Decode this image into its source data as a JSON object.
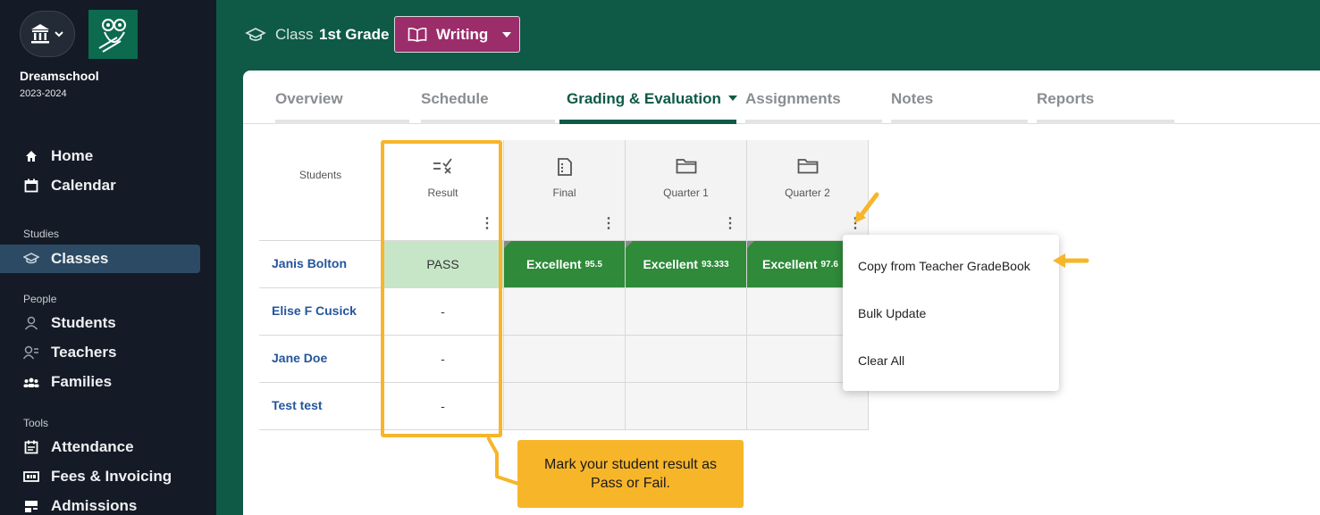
{
  "sidebar": {
    "school_name": "Dreamschool",
    "school_year": "2023-2024",
    "items": [
      {
        "label": "Home",
        "icon": "home-icon"
      },
      {
        "label": "Calendar",
        "icon": "calendar-icon"
      },
      {
        "label": "Classes",
        "icon": "graduation-cap-icon",
        "active": true
      },
      {
        "label": "Students",
        "icon": "person-icon"
      },
      {
        "label": "Teachers",
        "icon": "teacher-icon"
      },
      {
        "label": "Families",
        "icon": "families-icon"
      },
      {
        "label": "Attendance",
        "icon": "attendance-icon"
      },
      {
        "label": "Fees & Invoicing",
        "icon": "invoice-icon"
      },
      {
        "label": "Admissions",
        "icon": "admissions-icon"
      }
    ],
    "sections": {
      "studies": "Studies",
      "people": "People",
      "tools": "Tools"
    }
  },
  "topbar": {
    "class_label": "Class",
    "grade": "1st Grade",
    "subject": "Writing"
  },
  "tabs": [
    "Overview",
    "Schedule",
    "Grading & Evaluation",
    "Assignments",
    "Notes",
    "Reports"
  ],
  "active_tab": "Grading & Evaluation",
  "grid": {
    "students_header": "Students",
    "columns": [
      {
        "label": "Result",
        "icon": "result-check-icon"
      },
      {
        "label": "Final",
        "icon": "document-icon"
      },
      {
        "label": "Quarter 1",
        "icon": "folder-icon"
      },
      {
        "label": "Quarter 2",
        "icon": "folder-icon"
      }
    ],
    "rows": [
      {
        "name": "Janis Bolton",
        "result": "PASS",
        "final_grade": "Excellent",
        "final_score": "95.5",
        "q1_grade": "Excellent",
        "q1_score": "93.333",
        "q2_grade": "Excellent",
        "q2_score": "97.6"
      },
      {
        "name": "Elise F Cusick",
        "result": "-"
      },
      {
        "name": "Jane Doe",
        "result": "-"
      },
      {
        "name": "Test test",
        "result": "-"
      }
    ]
  },
  "menu": {
    "items": [
      "Copy from Teacher GradeBook",
      "Bulk Update",
      "Clear All"
    ]
  },
  "callout": {
    "text": "Mark your student result as Pass or Fail."
  },
  "colors": {
    "brand_green": "#0e5a46",
    "sidebar_bg": "#141b26",
    "subject_button": "#9b2d6b",
    "excellent_green": "#2f8a3a",
    "pass_green": "#c7e6c8",
    "highlight": "#f7b52a",
    "student_link": "#24559c"
  }
}
